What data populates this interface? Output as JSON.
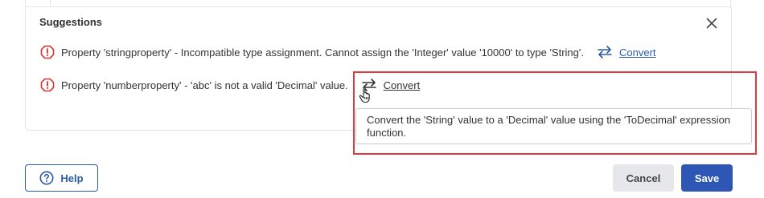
{
  "suggestions": {
    "title": "Suggestions",
    "items": [
      {
        "message": "Property 'stringproperty' - Incompatible type assignment. Cannot assign the 'Integer' value '10000' to type 'String'.",
        "action_label": "Convert"
      },
      {
        "message": "Property 'numberproperty' - 'abc' is not a valid 'Decimal' value.",
        "action_label": "Convert",
        "tooltip": "Convert the 'String' value to a 'Decimal' value using the 'ToDecimal' expression function."
      }
    ]
  },
  "footer": {
    "help_label": "Help",
    "cancel_label": "Cancel",
    "save_label": "Save"
  },
  "colors": {
    "accent": "#2e56b4",
    "link": "#2b5aa8",
    "warning": "#d93030",
    "highlight": "#e0393e"
  },
  "icons": {
    "close": "close-icon",
    "warning": "warning-octagon-icon",
    "convert": "swap-arrows-icon",
    "help": "help-circle-icon",
    "cursor": "hand-pointer-icon"
  }
}
